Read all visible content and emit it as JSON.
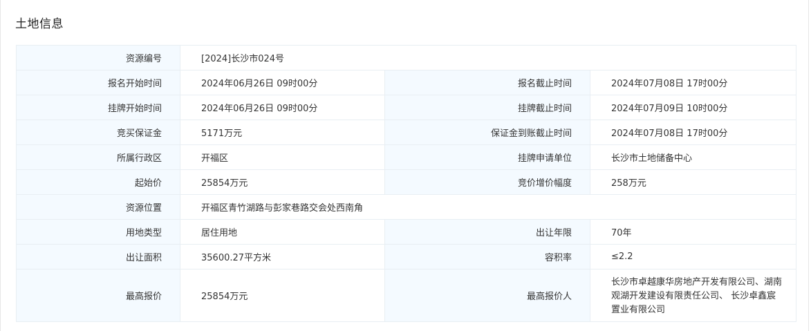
{
  "section_title": "土地信息",
  "rows": {
    "r0": {
      "l1": "资源编号",
      "v1": "[2024]长沙市024号"
    },
    "r1": {
      "l1": "报名开始时间",
      "v1": "2024年06月26日 09时00分",
      "l2": "报名截止时间",
      "v2": "2024年07月08日 17时00分"
    },
    "r2": {
      "l1": "挂牌开始时间",
      "v1": "2024年06月26日 09时00分",
      "l2": "挂牌截止时间",
      "v2": "2024年07月09日 10时00分"
    },
    "r3": {
      "l1": "竞买保证金",
      "v1": "5171万元",
      "l2": "保证金到账截止时间",
      "v2": "2024年07月08日 17时00分"
    },
    "r4": {
      "l1": "所属行政区",
      "v1": "开福区",
      "l2": "挂牌申请单位",
      "v2": "长沙市土地储备中心"
    },
    "r5": {
      "l1": "起始价",
      "v1": "25854万元",
      "l2": "竞价增价幅度",
      "v2": "258万元"
    },
    "r6": {
      "l1": "资源位置",
      "v1": "开福区青竹湖路与彭家巷路交会处西南角"
    },
    "r7": {
      "l1": "用地类型",
      "v1": "居住用地",
      "l2": "出让年限",
      "v2": "70年"
    },
    "r8": {
      "l1": "出让面积",
      "v1": "35600.27平方米",
      "l2": "容积率",
      "v2": "≤2.2"
    },
    "r9": {
      "l1": "最高报价",
      "v1": "25854万元",
      "l2": "最高报价人",
      "v2": "长沙市卓越康华房地产开发有限公司、湖南观湖开发建设有限责任公司、 长沙卓鑫宸置业有限公司"
    }
  }
}
